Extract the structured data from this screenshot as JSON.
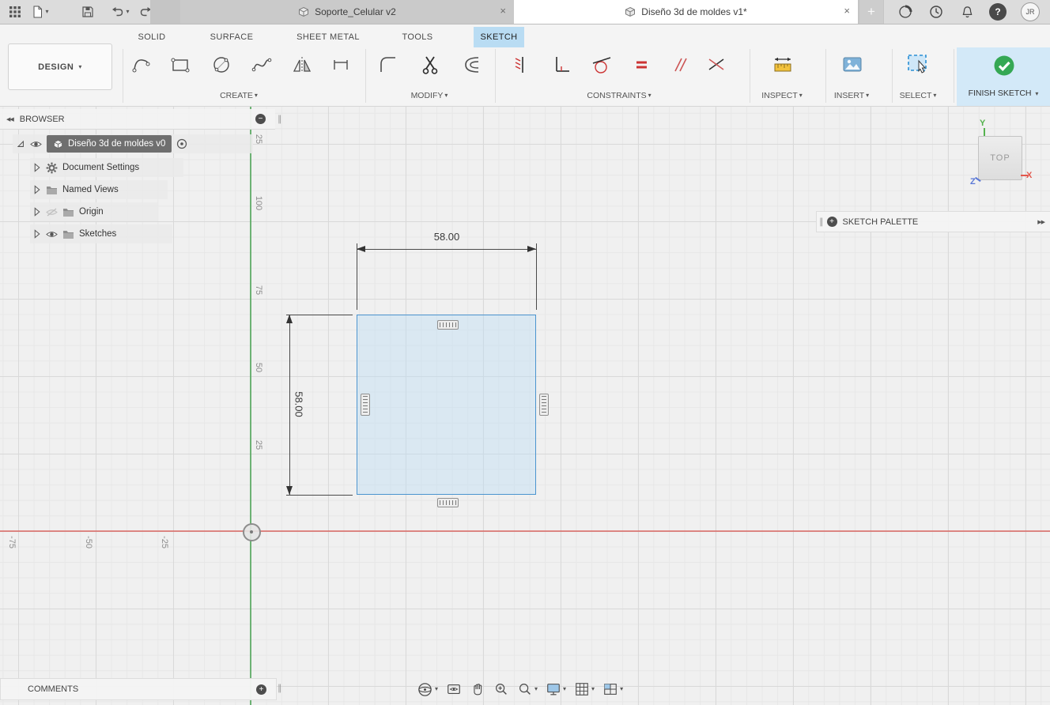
{
  "glyphs": {
    "caret": "▾",
    "close": "×",
    "plus": "+",
    "minus": "−",
    "grip": "∥",
    "collapse_left": "◀◀",
    "expand_right": "▶▶"
  },
  "titlebar": {
    "tabs": [
      {
        "label": "Soporte_Celular v2",
        "active": false
      },
      {
        "label": "Diseño 3d de moldes v1*",
        "active": true
      }
    ],
    "help": "?",
    "avatar": "JR"
  },
  "ribbon": {
    "design_menu": "DESIGN",
    "tabs": [
      {
        "label": "SOLID"
      },
      {
        "label": "SURFACE"
      },
      {
        "label": "SHEET METAL"
      },
      {
        "label": "TOOLS"
      },
      {
        "label": "SKETCH",
        "active": true
      }
    ],
    "groups": [
      {
        "label": "CREATE"
      },
      {
        "label": "MODIFY"
      },
      {
        "label": "CONSTRAINTS"
      },
      {
        "label": "INSPECT"
      },
      {
        "label": "INSERT"
      },
      {
        "label": "SELECT"
      }
    ],
    "finish_sketch": "FINISH SKETCH",
    "accent_blue": "#b9dcf3",
    "finish_bg": "#d3e9f8",
    "finish_green": "#35a854"
  },
  "browser": {
    "header": "BROWSER",
    "root_label": "Diseño 3d de moldes v0",
    "items": [
      {
        "label": "Document Settings"
      },
      {
        "label": "Named Views"
      },
      {
        "label": "Origin"
      },
      {
        "label": "Sketches"
      }
    ]
  },
  "canvas": {
    "dimension_width": "58.00",
    "dimension_height": "58.00",
    "y_axis_ticks": [
      "25",
      "100",
      "75",
      "50",
      "25"
    ],
    "x_axis_ticks": [
      "-75",
      "-50",
      "-25"
    ],
    "axis_x_color": "#d9534f",
    "axis_y_color": "#44a04e",
    "sketch_fill": "rgba(190,222,244,0.45)",
    "sketch_stroke": "#4b94cf"
  },
  "viewcube": {
    "face": "TOP",
    "axis_x": "X",
    "axis_y": "Y",
    "axis_z": "Z"
  },
  "sketch_palette": {
    "header": "SKETCH PALETTE"
  },
  "comments": {
    "header": "COMMENTS"
  }
}
